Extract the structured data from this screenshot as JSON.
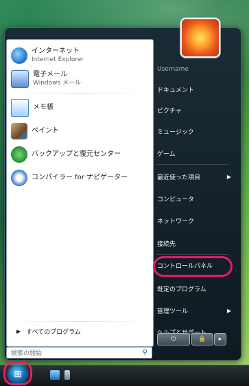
{
  "left_pane": {
    "pinned": [
      {
        "title": "インターネット",
        "subtitle": "Internet Explorer",
        "icon": "internet-explorer-icon"
      },
      {
        "title": "電子メール",
        "subtitle": "Windows メール",
        "icon": "mail-icon"
      }
    ],
    "recent": [
      {
        "title": "メモ帳",
        "icon": "notepad-icon"
      },
      {
        "title": "ペイント",
        "icon": "paint-icon"
      },
      {
        "title": "バックアップと復元センター",
        "icon": "backup-icon"
      },
      {
        "title": "コンパイラー for ナビゲーター",
        "icon": "info-icon"
      }
    ],
    "all_programs": "すべてのプログラム",
    "search_placeholder": "検索の開始"
  },
  "right_pane": {
    "user_name": "Username",
    "items": [
      {
        "label": "ドキュメント",
        "submenu": false
      },
      {
        "label": "ピクチャ",
        "submenu": false
      },
      {
        "label": "ミュージック",
        "submenu": false
      },
      {
        "label": "ゲーム",
        "submenu": false
      },
      {
        "label": "最近使った項目",
        "submenu": true
      },
      {
        "label": "コンピュータ",
        "submenu": false
      },
      {
        "label": "ネットワーク",
        "submenu": false
      },
      {
        "label": "接続先",
        "submenu": false
      },
      {
        "label": "コントロールパネル",
        "submenu": false,
        "highlighted": true
      },
      {
        "label": "既定のプログラム",
        "submenu": false
      },
      {
        "label": "管理ツール",
        "submenu": true
      },
      {
        "label": "ヘルプとサポート",
        "submenu": false
      }
    ]
  },
  "power": {
    "power_icon": "power-icon",
    "lock_icon": "lock-icon",
    "arrow": "▸"
  },
  "taskbar": {
    "start_orb": "windows-start-orb"
  },
  "colors": {
    "highlight": "#e61c6a",
    "menu_bg": "#16232b"
  }
}
